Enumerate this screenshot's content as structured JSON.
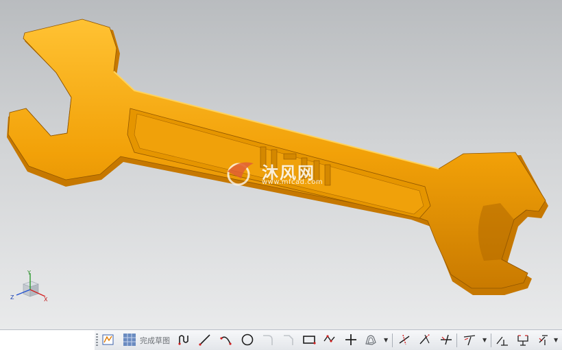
{
  "toolbar": {
    "finish_sketch_label": "完成草图",
    "items": [
      {
        "name": "sketch-icon",
        "label": ""
      },
      {
        "name": "sketch-grid-icon",
        "label": ""
      },
      {
        "name": "profile-icon",
        "label": ""
      },
      {
        "name": "line-icon",
        "label": ""
      },
      {
        "name": "arc-icon",
        "label": ""
      },
      {
        "name": "circle-icon",
        "label": ""
      },
      {
        "name": "fillet-icon",
        "label": ""
      },
      {
        "name": "chamfer-icon",
        "label": ""
      },
      {
        "name": "rectangle-icon",
        "label": ""
      },
      {
        "name": "polygon-icon",
        "label": ""
      },
      {
        "name": "point-icon",
        "label": ""
      },
      {
        "name": "offset-curve-icon",
        "label": ""
      },
      {
        "name": "quick-trim-icon",
        "label": ""
      },
      {
        "name": "quick-extend-icon",
        "label": ""
      },
      {
        "name": "make-corner-icon",
        "label": ""
      },
      {
        "name": "mirror-icon",
        "label": ""
      },
      {
        "name": "constraint-icon",
        "label": ""
      },
      {
        "name": "dimension-icon",
        "label": ""
      },
      {
        "name": "auto-constrain-icon",
        "label": ""
      }
    ]
  },
  "triad": {
    "x_label": "X",
    "y_label": "Y",
    "z_label": "Z"
  },
  "watermark": {
    "title": "沐风网",
    "url": "www.mfcad.com"
  },
  "colors": {
    "model_orange": "#f2a108",
    "model_shadow": "#b86d00",
    "model_highlight": "#ffc233",
    "background_top": "#b9bcbf",
    "background_bottom": "#e9eaeb"
  }
}
